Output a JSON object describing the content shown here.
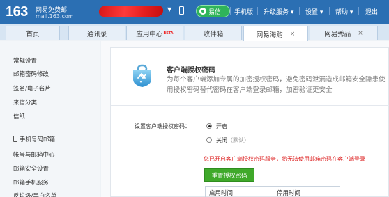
{
  "header": {
    "logo_number": "163",
    "logo_text": "网易免费邮",
    "logo_domain": "mail.163.com",
    "account_caret": "▼",
    "yixin_label": "易信",
    "links": [
      "手机版",
      "升级服务",
      "设置",
      "帮助",
      "退出"
    ],
    "dropdown_caret": "▾"
  },
  "tabs": [
    {
      "label": "首页"
    },
    {
      "label": "通讯录"
    },
    {
      "label": "应用中心",
      "badge": "BETA"
    },
    {
      "label": "收件箱"
    },
    {
      "label": "网易海购",
      "close": "×"
    },
    {
      "label": "网易秀品",
      "close": "×"
    }
  ],
  "sidebar": {
    "items": [
      "常规设置",
      "邮箱密码修改",
      "签名/电子名片",
      "来信分类",
      "信纸",
      "手机号码邮箱",
      "帐号与邮箱中心",
      "邮箱安全设置",
      "邮箱手机服务",
      "反垃圾/黑白名单"
    ]
  },
  "main": {
    "title": "客户端授权密码",
    "description": "为每个客户端添加专属的加密授权密码，避免密码泄漏造成邮箱安全隐患使用授权密码替代密码在客户端登录邮箱，加密验证更安全",
    "setting_label": "设置客户端授权密码：",
    "option_on": "开启",
    "option_off": "关闭",
    "option_off_hint": "（默认）",
    "selected": "开启",
    "warning": "您已开启客户端授权密码服务，将无法使用邮箱密码在客户端登录",
    "reset_button": "重置授权密码",
    "table_headers": [
      "启用时间",
      "停用时间"
    ]
  },
  "colors": {
    "topbar": "#2b6fb3",
    "accent_green": "#3fa92a",
    "warning_red": "#dd2222"
  }
}
